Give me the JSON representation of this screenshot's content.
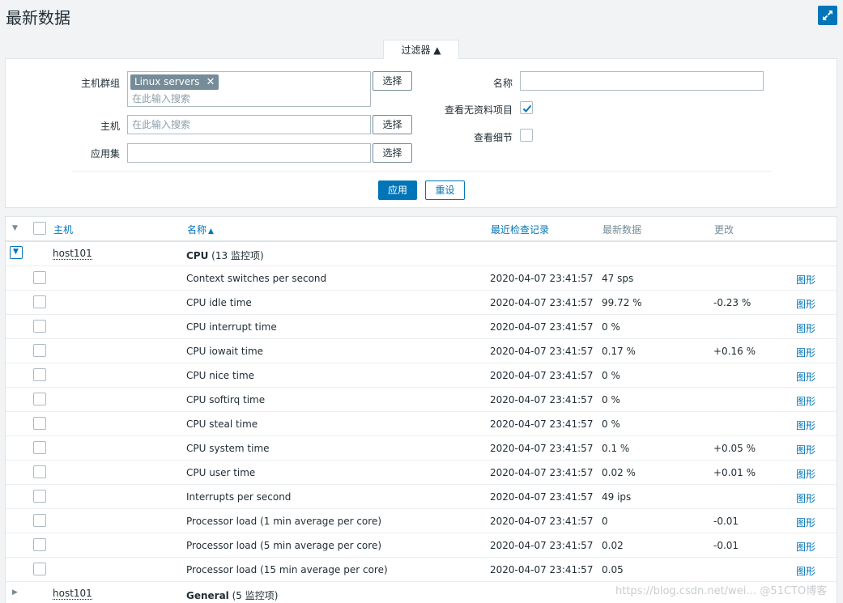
{
  "header": {
    "title": "最新数据",
    "fullscreen_icon": "fullscreen-icon"
  },
  "filter": {
    "tab_label": "过滤器 ▲",
    "host_group_label": "主机群组",
    "host_group_tag": "Linux servers",
    "host_group_placeholder": "在此输入搜索",
    "host_label": "主机",
    "host_placeholder": "在此输入搜索",
    "application_label": "应用集",
    "application_value": "",
    "select_label": "选择",
    "name_label": "名称",
    "name_value": "",
    "show_no_data_label": "查看无资料项目",
    "show_no_data_checked": true,
    "show_details_label": "查看细节",
    "show_details_checked": false,
    "apply_label": "应用",
    "reset_label": "重设"
  },
  "table": {
    "columns": {
      "host": "主机",
      "name": "名称",
      "last_check": "最近检查记录",
      "last_value": "最新数据",
      "change": "更改"
    },
    "groups": [
      {
        "host": "host101",
        "application": "CPU",
        "count_text": " (13 监控项)",
        "expanded": true
      },
      {
        "host": "host101",
        "application": "General",
        "count_text": " (5 监控项)",
        "expanded": false
      }
    ],
    "items": [
      {
        "name": "Context switches per second",
        "last_check": "2020-04-07 23:41:57",
        "last_value": "47 sps",
        "change": "",
        "graph": "图形"
      },
      {
        "name": "CPU idle time",
        "last_check": "2020-04-07 23:41:57",
        "last_value": "99.72 %",
        "change": "-0.23 %",
        "graph": "图形"
      },
      {
        "name": "CPU interrupt time",
        "last_check": "2020-04-07 23:41:57",
        "last_value": "0 %",
        "change": "",
        "graph": "图形"
      },
      {
        "name": "CPU iowait time",
        "last_check": "2020-04-07 23:41:57",
        "last_value": "0.17 %",
        "change": "+0.16 %",
        "graph": "图形"
      },
      {
        "name": "CPU nice time",
        "last_check": "2020-04-07 23:41:57",
        "last_value": "0 %",
        "change": "",
        "graph": "图形"
      },
      {
        "name": "CPU softirq time",
        "last_check": "2020-04-07 23:41:57",
        "last_value": "0 %",
        "change": "",
        "graph": "图形"
      },
      {
        "name": "CPU steal time",
        "last_check": "2020-04-07 23:41:57",
        "last_value": "0 %",
        "change": "",
        "graph": "图形"
      },
      {
        "name": "CPU system time",
        "last_check": "2020-04-07 23:41:57",
        "last_value": "0.1 %",
        "change": "+0.05 %",
        "graph": "图形"
      },
      {
        "name": "CPU user time",
        "last_check": "2020-04-07 23:41:57",
        "last_value": "0.02 %",
        "change": "+0.01 %",
        "graph": "图形"
      },
      {
        "name": "Interrupts per second",
        "last_check": "2020-04-07 23:41:57",
        "last_value": "49 ips",
        "change": "",
        "graph": "图形"
      },
      {
        "name": "Processor load (1 min average per core)",
        "last_check": "2020-04-07 23:41:57",
        "last_value": "0",
        "change": "-0.01",
        "graph": "图形"
      },
      {
        "name": "Processor load (5 min average per core)",
        "last_check": "2020-04-07 23:41:57",
        "last_value": "0.02",
        "change": "-0.01",
        "graph": "图形"
      },
      {
        "name": "Processor load (15 min average per core)",
        "last_check": "2020-04-07 23:41:57",
        "last_value": "0.05",
        "change": "",
        "graph": "图形"
      }
    ]
  },
  "watermark": "https://blog.csdn.net/wei… @51CTO博客",
  "colors": {
    "accent": "#0275b8",
    "background": "#f2f3f5",
    "tag": "#768d99"
  }
}
